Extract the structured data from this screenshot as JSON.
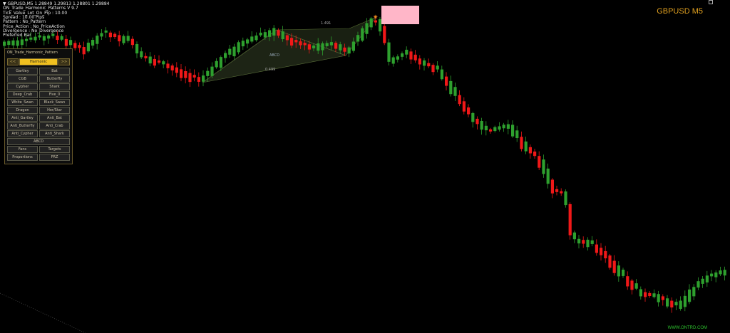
{
  "window": {
    "symbol_title": "GBPUSD M5",
    "watermark": "WWW.ONTRD.COM"
  },
  "info": {
    "lines": [
      "▼ GBPUSD,M5  1.28849 1.29813 1.28801 1.29884",
      "ON_Trade_Harmonic_Patterns V 9.7",
      "Tick_Value_Lot_On_Pip : 10.00",
      "Spread : 10.00  Pips",
      "Pattern : No_Pattern",
      "Price_Action : No_PriceAction",
      "Divergence : No_Divergence",
      "Preferred Bar"
    ]
  },
  "pattern": {
    "name": "ABCD",
    "ratio_top": "1.491",
    "ratio_bottom": "0.499"
  },
  "panel": {
    "title": "ON_Trade_Harmonic_Pattern",
    "tabs": [
      "<<",
      "Harmonic",
      ">>"
    ],
    "buttons": [
      [
        "Gartley",
        "Bat"
      ],
      [
        "CGB",
        "Butterfly"
      ],
      [
        "Cypher",
        "Shark"
      ],
      [
        "Deep_Crab",
        "Five_0"
      ],
      [
        "White_Swan",
        "Black_Swan"
      ],
      [
        "Dragon",
        "Her/Star"
      ],
      [
        "Anti_Gartley",
        "Anti_Bat"
      ],
      [
        "Anti_Butterfly",
        "Anti_Crab"
      ],
      [
        "Anti_Cypher",
        "Anti_Shark"
      ]
    ],
    "abcd_label": "ABCD",
    "bottom_buttons": [
      [
        "Fans",
        "Targets"
      ],
      [
        "Proportions",
        "PRZ"
      ]
    ]
  },
  "colors": {
    "bull": "#2ea02e",
    "bear": "#f01818",
    "pattern_fill": "#2e3a20",
    "accent": "#f0c020"
  }
}
